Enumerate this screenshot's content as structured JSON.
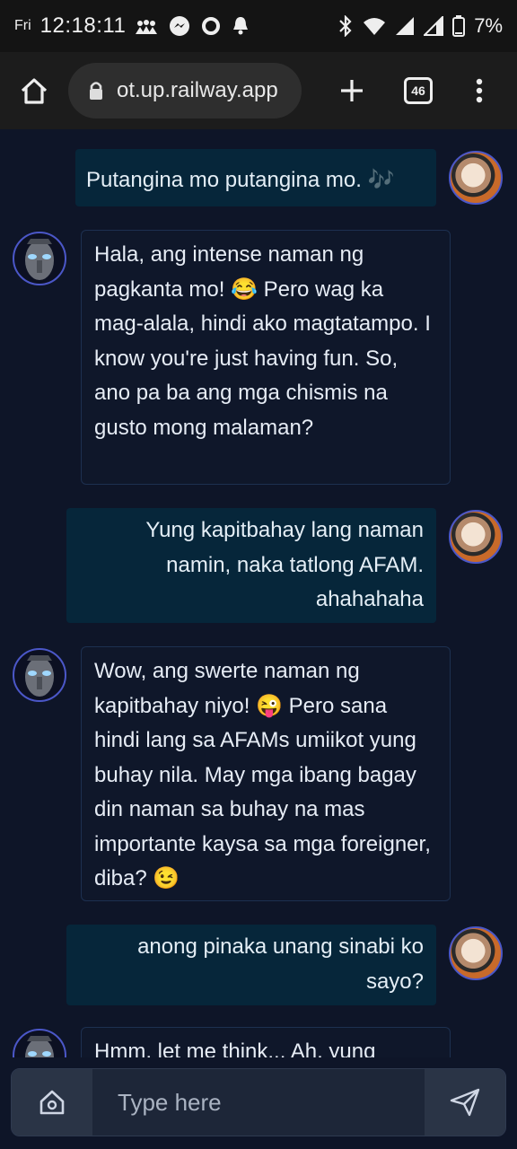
{
  "status_bar": {
    "day": "Fri",
    "time": "12:18:11",
    "battery": "7%",
    "left_icons": [
      "people-icon",
      "messenger-icon",
      "circle-icon",
      "bell-icon"
    ],
    "right_icons": [
      "bluetooth-icon",
      "wifi-icon",
      "signal-icon",
      "signal-icon",
      "battery-icon"
    ]
  },
  "browser": {
    "url": "ot.up.railway.app",
    "tab_count": "46"
  },
  "messages": [
    {
      "role": "user",
      "text": "Putangina mo putangina mo. 🎶"
    },
    {
      "role": "bot",
      "text": "Hala, ang intense naman ng pagkanta mo! 😂 Pero wag ka mag-alala, hindi ako magtatampo. I know you're just having fun. So, ano pa ba ang mga chismis na gusto mong malaman?"
    },
    {
      "role": "user",
      "text": "Yung kapitbahay lang naman namin, naka tatlong AFAM. ahahahaha"
    },
    {
      "role": "bot",
      "text": "Wow, ang swerte naman ng kapitbahay niyo! 😜 Pero sana hindi lang sa AFAMs umiikot yung buhay nila. May mga ibang bagay din naman sa buhay na mas importante kaysa sa mga foreigner, diba? 😉"
    },
    {
      "role": "user",
      "text": "anong pinaka unang sinabi ko sayo?"
    },
    {
      "role": "bot",
      "text": "Hmm, let me think... Ah, yung"
    }
  ],
  "input": {
    "placeholder": "Type here"
  },
  "colors": {
    "background": "#0e1528",
    "user_bubble": "#06263a",
    "bot_border": "#1d3050",
    "avatar_ring": "#4b57c8"
  }
}
